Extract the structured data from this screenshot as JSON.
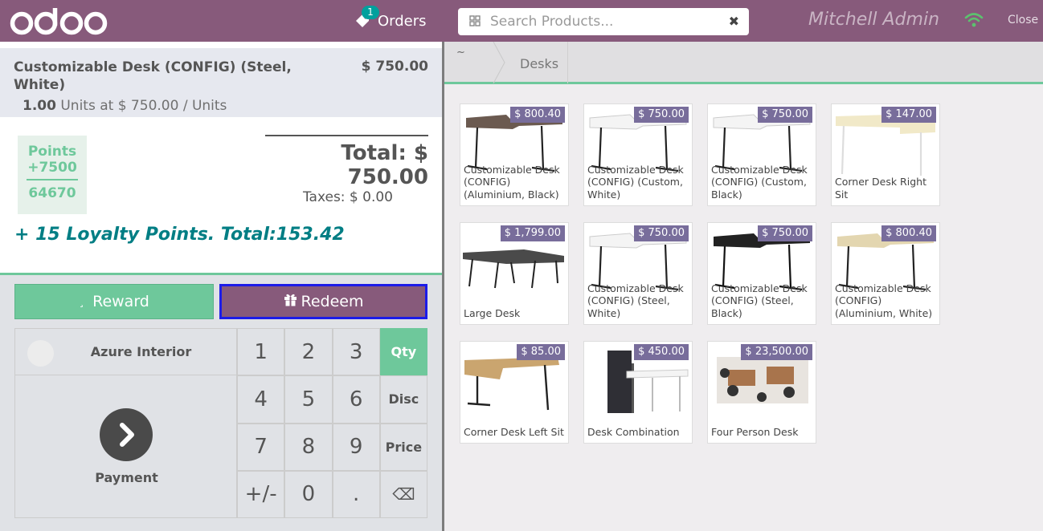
{
  "header": {
    "logo_text": "odoo",
    "orders_label": "Orders",
    "orders_count": "1",
    "search_placeholder": "Search Products...",
    "cashier": "Mitchell Admin",
    "close_label": "Close"
  },
  "order": {
    "line": {
      "name": "Customizable Desk (CONFIG) (Steel, White)",
      "price": "$ 750.00",
      "qty": "1.00",
      "unit_info": "Units at $ 750.00 / Units"
    },
    "points": {
      "label": "Points",
      "gained": "+7500",
      "balance": "64670"
    },
    "total": "Total: $ 750.00",
    "taxes": "Taxes: $ 0.00",
    "loyalty_text": "+ 15 Loyalty Points. Total:153.42"
  },
  "controls": {
    "reward_label": "Reward",
    "reward_glyph": "¸",
    "redeem_label": "Redeem",
    "customer": "Azure Interior",
    "payment_label": "Payment",
    "numpad": [
      "1",
      "2",
      "3",
      "Qty",
      "4",
      "5",
      "6",
      "Disc",
      "7",
      "8",
      "9",
      "Price",
      "+/-",
      "0",
      ".",
      "⌫"
    ]
  },
  "breadcrumb": {
    "home": "~",
    "category": "Desks"
  },
  "products": [
    {
      "name": "Customizable Desk (CONFIG) (Aluminium, Black)",
      "price": "$ 800.40",
      "style": "dark-top"
    },
    {
      "name": "Customizable Desk (CONFIG) (Custom, White)",
      "price": "$ 750.00",
      "style": "white-top"
    },
    {
      "name": "Customizable Desk (CONFIG) (Custom, Black)",
      "price": "$ 750.00",
      "style": "white-top"
    },
    {
      "name": "Corner Desk Right Sit",
      "price": "$ 147.00",
      "style": "corner-light"
    },
    {
      "name": "Large Desk",
      "price": "$ 1,799.00",
      "style": "large"
    },
    {
      "name": "Customizable Desk (CONFIG) (Steel, White)",
      "price": "$ 750.00",
      "style": "white-top"
    },
    {
      "name": "Customizable Desk (CONFIG) (Steel, Black)",
      "price": "$ 750.00",
      "style": "black-top"
    },
    {
      "name": "Customizable Desk (CONFIG) (Aluminium, White)",
      "price": "$ 800.40",
      "style": "oak-top"
    },
    {
      "name": "Corner Desk Left Sit",
      "price": "$ 85.00",
      "style": "corner-oak"
    },
    {
      "name": "Desk Combination",
      "price": "$ 450.00",
      "style": "combo"
    },
    {
      "name": "Four Person Desk",
      "price": "$ 23,500.00",
      "style": "four"
    }
  ]
}
